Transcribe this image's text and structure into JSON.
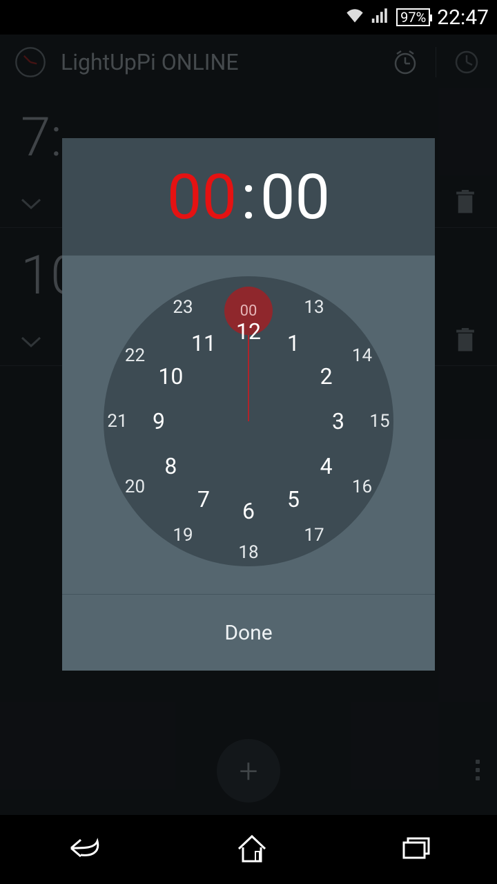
{
  "statusbar": {
    "battery": "97%",
    "time": "22:47"
  },
  "header": {
    "title": "LightUpPi ONLINE"
  },
  "alarms": [
    {
      "time_prefix": "7:"
    },
    {
      "time_prefix": "10"
    }
  ],
  "overflow_label": "more",
  "fab_label": "+",
  "timepicker": {
    "hour": "00",
    "minute": "00",
    "selected_label": "00",
    "done": "Done",
    "inner_hours": [
      "12",
      "1",
      "2",
      "3",
      "4",
      "5",
      "6",
      "7",
      "8",
      "9",
      "10",
      "11"
    ],
    "outer_hours": [
      "00",
      "13",
      "14",
      "15",
      "16",
      "17",
      "18",
      "19",
      "20",
      "21",
      "22",
      "23"
    ]
  },
  "colors": {
    "accent": "#e51212",
    "dial_bg": "#3d4b53"
  }
}
